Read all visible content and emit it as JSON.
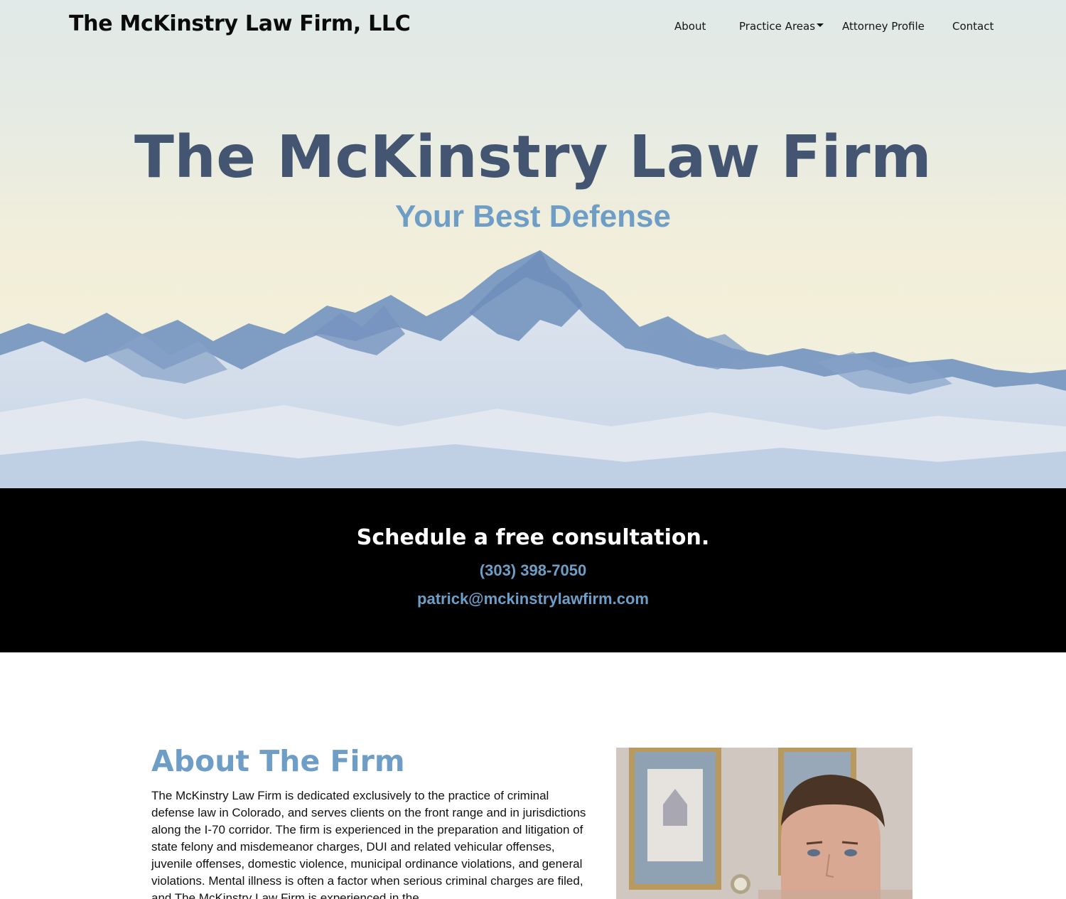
{
  "site": {
    "title": "The McKinstry Law Firm, LLC"
  },
  "nav": {
    "items": [
      {
        "label": "About"
      },
      {
        "label": "Practice Areas",
        "has_dropdown": true
      },
      {
        "label": "Attorney Profile"
      },
      {
        "label": "Contact"
      }
    ]
  },
  "hero": {
    "title": "The McKinstry Law Firm",
    "subtitle": "Your Best Defense"
  },
  "cta": {
    "title": "Schedule a free consultation.",
    "phone": "(303) 398-7050",
    "email": "patrick@mckinstrylawfirm.com"
  },
  "about": {
    "heading": "About The Firm",
    "body": "The McKinstry Law Firm is dedicated exclusively to the practice of criminal defense law in Colorado, and serves clients on the front range and in jurisdictions along the I-70 corridor. The firm is experienced in the preparation and litigation of state felony and misdemeanor charges, DUI and related vehicular offenses, juvenile offenses, domestic violence, municipal ordinance violations, and general violations. Mental illness is often a factor when serious criminal charges are filed, and The McKinstry Law Firm is experienced in the"
  },
  "colors": {
    "accent": "#6e9ec6",
    "hero_title": "#435570",
    "cta_background": "#000000"
  },
  "icons": {
    "dropdown": "caret-down-icon"
  }
}
